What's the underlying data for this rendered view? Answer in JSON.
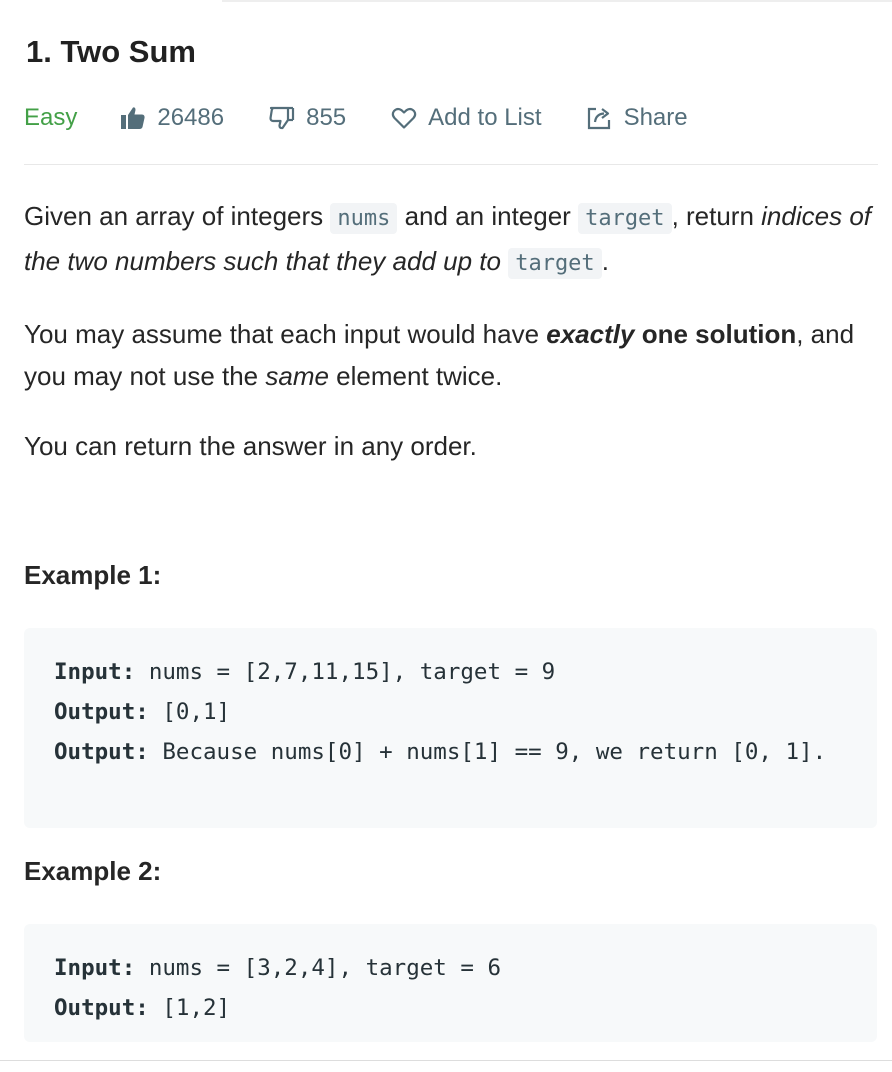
{
  "problem": {
    "title": "1. Two Sum",
    "difficulty": "Easy",
    "likes": "26486",
    "dislikes": "855",
    "add_to_list": "Add to List",
    "share": "Share",
    "colors": {
      "easy": "#43a047",
      "meta": "#546e7a"
    }
  },
  "description": {
    "p1_a": "Given an array of integers ",
    "p1_code1": "nums",
    "p1_b": " and an integer ",
    "p1_code2": "target",
    "p1_c": ", return ",
    "p1_em": "indices of the two numbers such that they add up to",
    "p1_d": " ",
    "p1_code3": "target",
    "p1_e": ".",
    "p2_a": "You may assume that each input would have ",
    "p2_bi": "exactly",
    "p2_b_space": " ",
    "p2_bold": "one solution",
    "p2_c": ", and you may not use the ",
    "p2_em": "same",
    "p2_d": " element twice.",
    "p3": "You can return the answer in any order."
  },
  "examples": [
    {
      "title": "Example 1:",
      "input_label": "Input:",
      "input_value": " nums = [2,7,11,15], target = 9",
      "output_label": "Output:",
      "output_value": " [0,1]",
      "explanation_label": "Output:",
      "explanation_value": " Because nums[0] + nums[1] == 9, we return [0, 1]."
    },
    {
      "title": "Example 2:",
      "input_label": "Input:",
      "input_value": " nums = [3,2,4], target = 6",
      "output_label": "Output:",
      "output_value": " [1,2]"
    }
  ],
  "icons": {
    "like": "thumbs-up-icon",
    "dislike": "thumbs-down-icon",
    "add": "heart-icon",
    "share": "share-icon"
  }
}
